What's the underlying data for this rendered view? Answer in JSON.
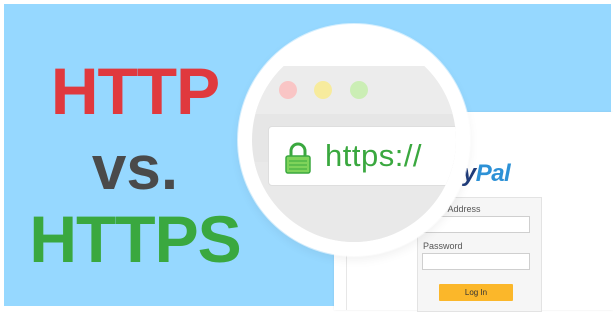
{
  "headline": {
    "http": "HTTP",
    "vs": "vs.",
    "https": "HTTPS"
  },
  "browser": {
    "url": "https://",
    "icons": {
      "lock": "lock-icon",
      "close": "traffic-light-red",
      "minimize": "traffic-light-yellow",
      "maximize": "traffic-light-green"
    }
  },
  "paypal": {
    "logo_dark": "ay",
    "logo_light": "Pal",
    "email_label": "Email Address",
    "password_label": "Password",
    "login_button": "Log In"
  },
  "colors": {
    "background": "#96d8ff",
    "http_red": "#e0393e",
    "vs_gray": "#4a4a4a",
    "https_green": "#3aa83f",
    "login_button": "#fbb72a"
  }
}
